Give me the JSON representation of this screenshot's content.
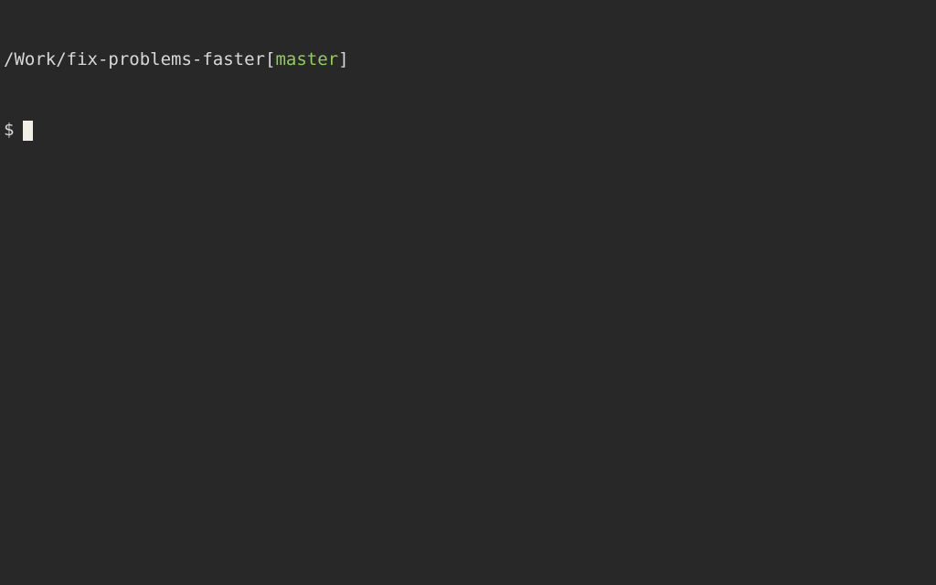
{
  "prompt": {
    "path": "/Work/fix-problems-faster",
    "bracket_open": "[",
    "branch": "master",
    "bracket_close": "]",
    "symbol": "$"
  },
  "colors": {
    "background": "#282828",
    "foreground": "#d8d8d8",
    "branch": "#8fce5a",
    "cursor": "#f2efe6"
  }
}
